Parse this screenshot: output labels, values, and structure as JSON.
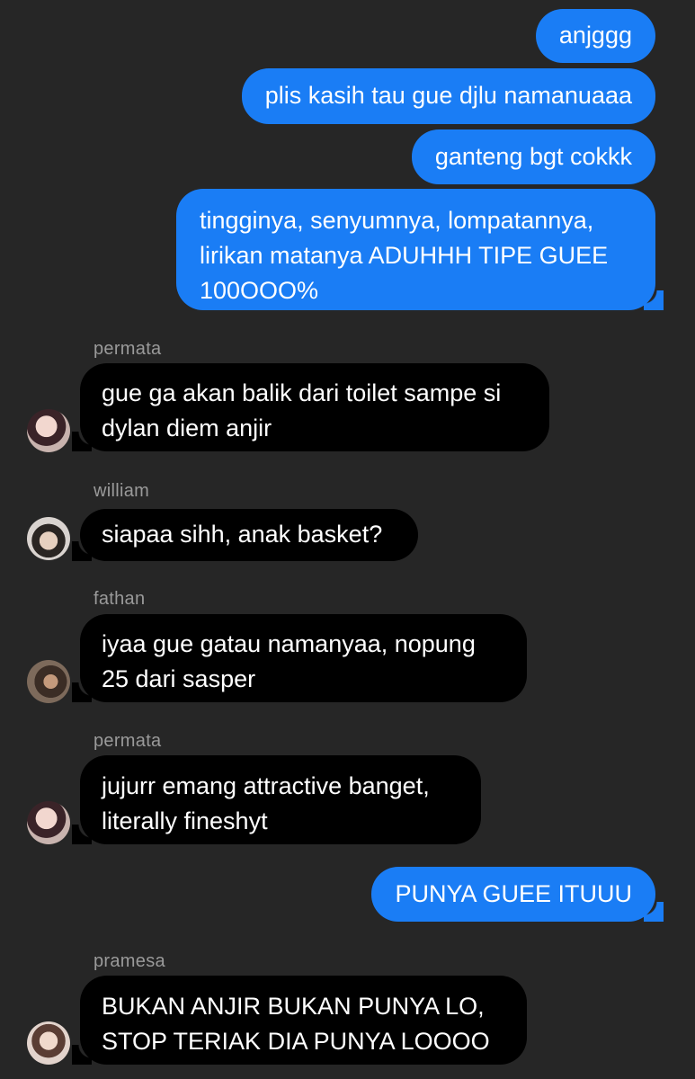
{
  "messages": [
    {
      "type": "outgoing",
      "lines": [
        "anjggg"
      ]
    },
    {
      "type": "outgoing",
      "lines": [
        "plis kasih tau gue djlu namanuaaa"
      ]
    },
    {
      "type": "outgoing",
      "lines": [
        "ganteng bgt cokkk"
      ]
    },
    {
      "type": "outgoing",
      "lines": [
        "tingginya, senyumnya, lompatannya,",
        "lirikan matanya ADUHHH TIPE GUEE",
        "100OOO%"
      ]
    },
    {
      "type": "incoming",
      "sender": "permata",
      "avatar": "permata-avatar",
      "lines": [
        "gue ga akan balik dari toilet sampe si",
        "dylan diem anjir"
      ]
    },
    {
      "type": "incoming",
      "sender": "william",
      "avatar": "william-avatar",
      "lines": [
        "siapaa sihh, anak basket?"
      ]
    },
    {
      "type": "incoming",
      "sender": "fathan",
      "avatar": "fathan-avatar",
      "lines": [
        "iyaa gue gatau namanyaa, nopung",
        "25 dari sasper"
      ]
    },
    {
      "type": "incoming",
      "sender": "permata",
      "avatar": "permata-avatar",
      "lines": [
        "jujurr emang attractive banget,",
        "literally fineshyt"
      ]
    },
    {
      "type": "outgoing",
      "lines": [
        "PUNYA GUEE ITUUU"
      ]
    },
    {
      "type": "incoming",
      "sender": "pramesa",
      "avatar": "pramesa-avatar",
      "lines": [
        "BUKAN ANJIR BUKAN PUNYA LO,",
        "STOP TERIAK DIA PUNYA LOOOO"
      ]
    }
  ],
  "colors": {
    "background": "#262626",
    "outgoing_bubble": "#1a7df5",
    "incoming_bubble": "#000000",
    "sender_name": "#9a9a9a",
    "text": "#ffffff"
  }
}
